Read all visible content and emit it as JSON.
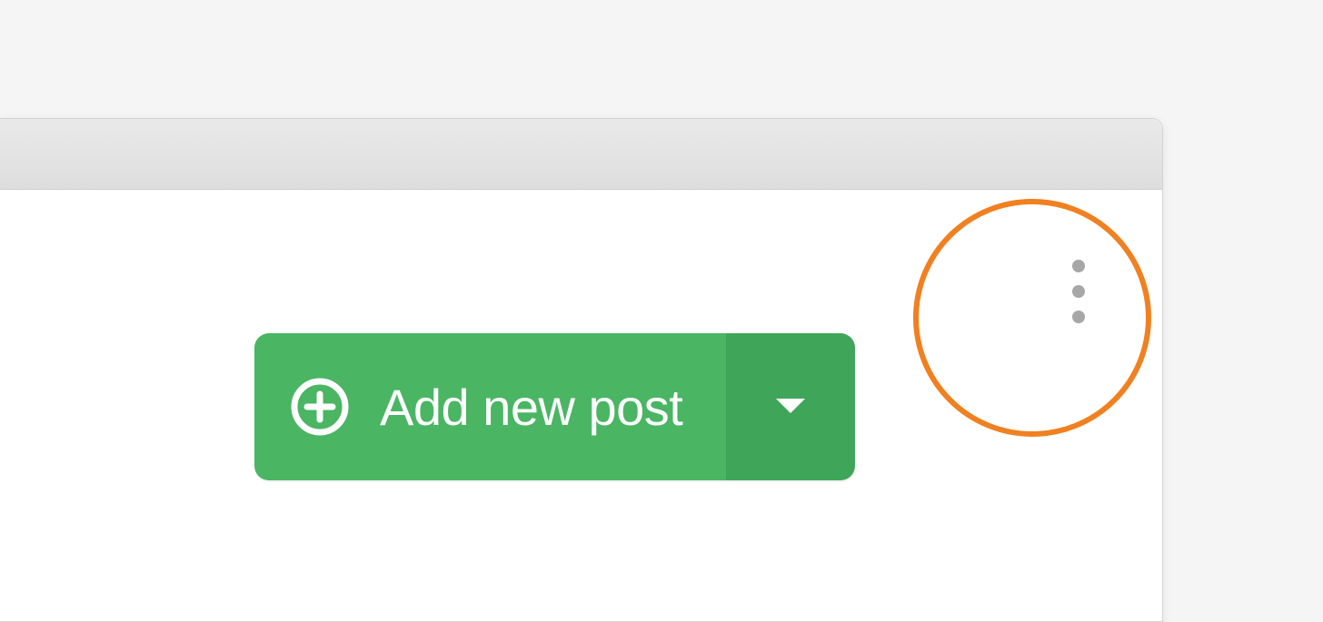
{
  "toolbar": {
    "add_new_post_label": "Add new post"
  },
  "icons": {
    "plus": "plus-icon",
    "chevron_down": "chevron-down-icon",
    "more_vertical": "more-options-icon"
  },
  "colors": {
    "button_primary": "#4ab563",
    "button_primary_dark": "#3fa558",
    "highlight_ring": "#f08020",
    "dot_grey": "#a7a7a7"
  }
}
